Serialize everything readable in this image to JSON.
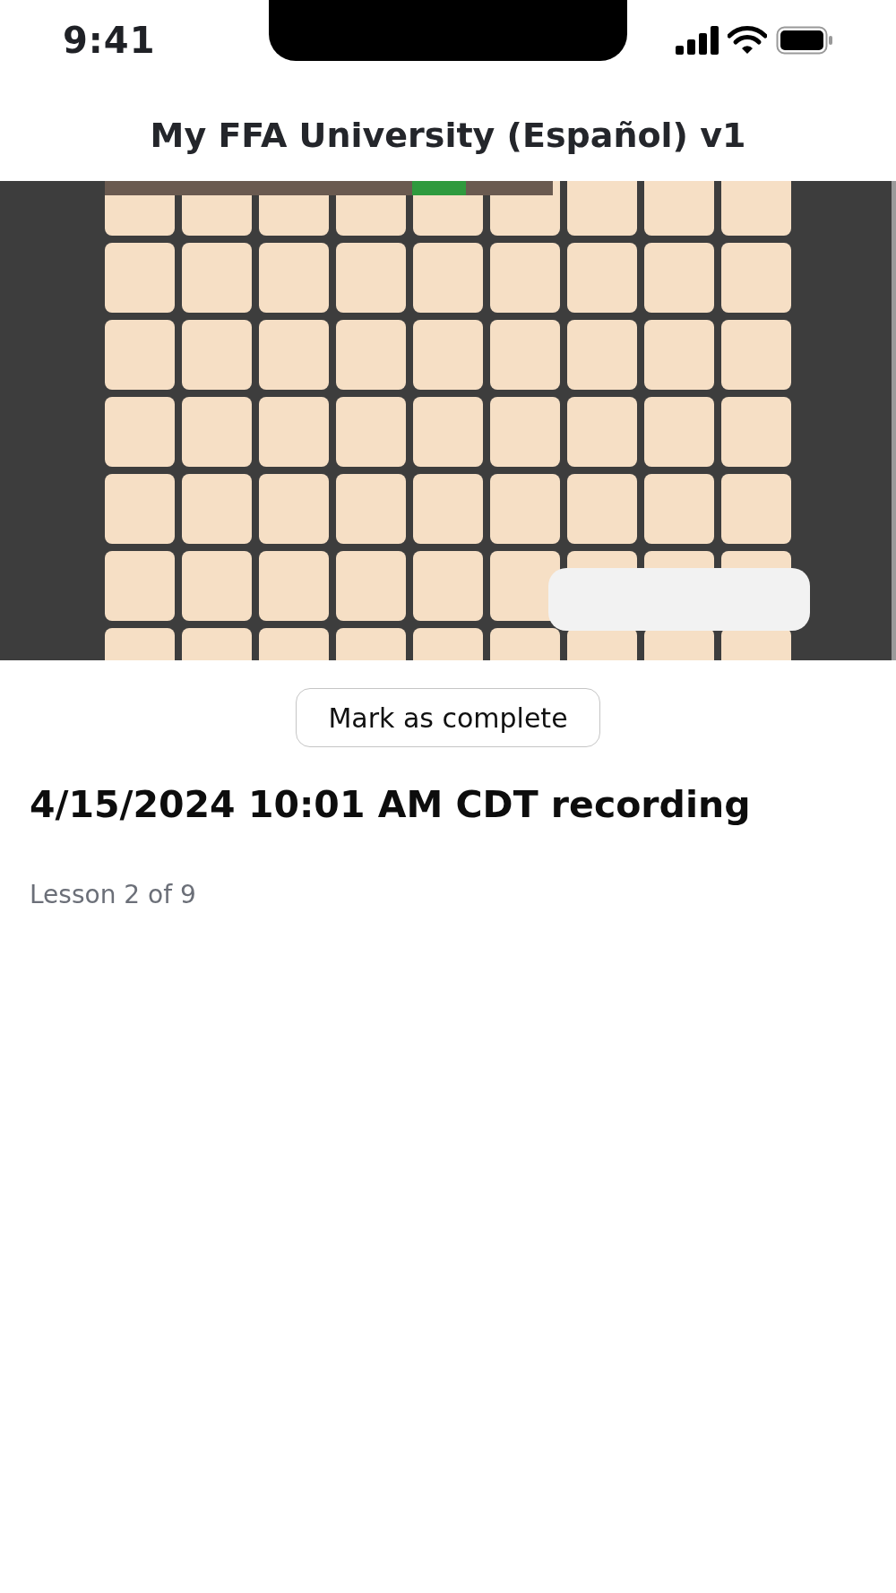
{
  "status_bar": {
    "time": "9:41"
  },
  "header": {
    "title": "My FFA University (Español) v1"
  },
  "complete_button": {
    "label": "Mark as complete"
  },
  "lesson": {
    "title": "4/15/2024 10:01 AM CDT recording",
    "progress": "Lesson 2 of 9"
  }
}
